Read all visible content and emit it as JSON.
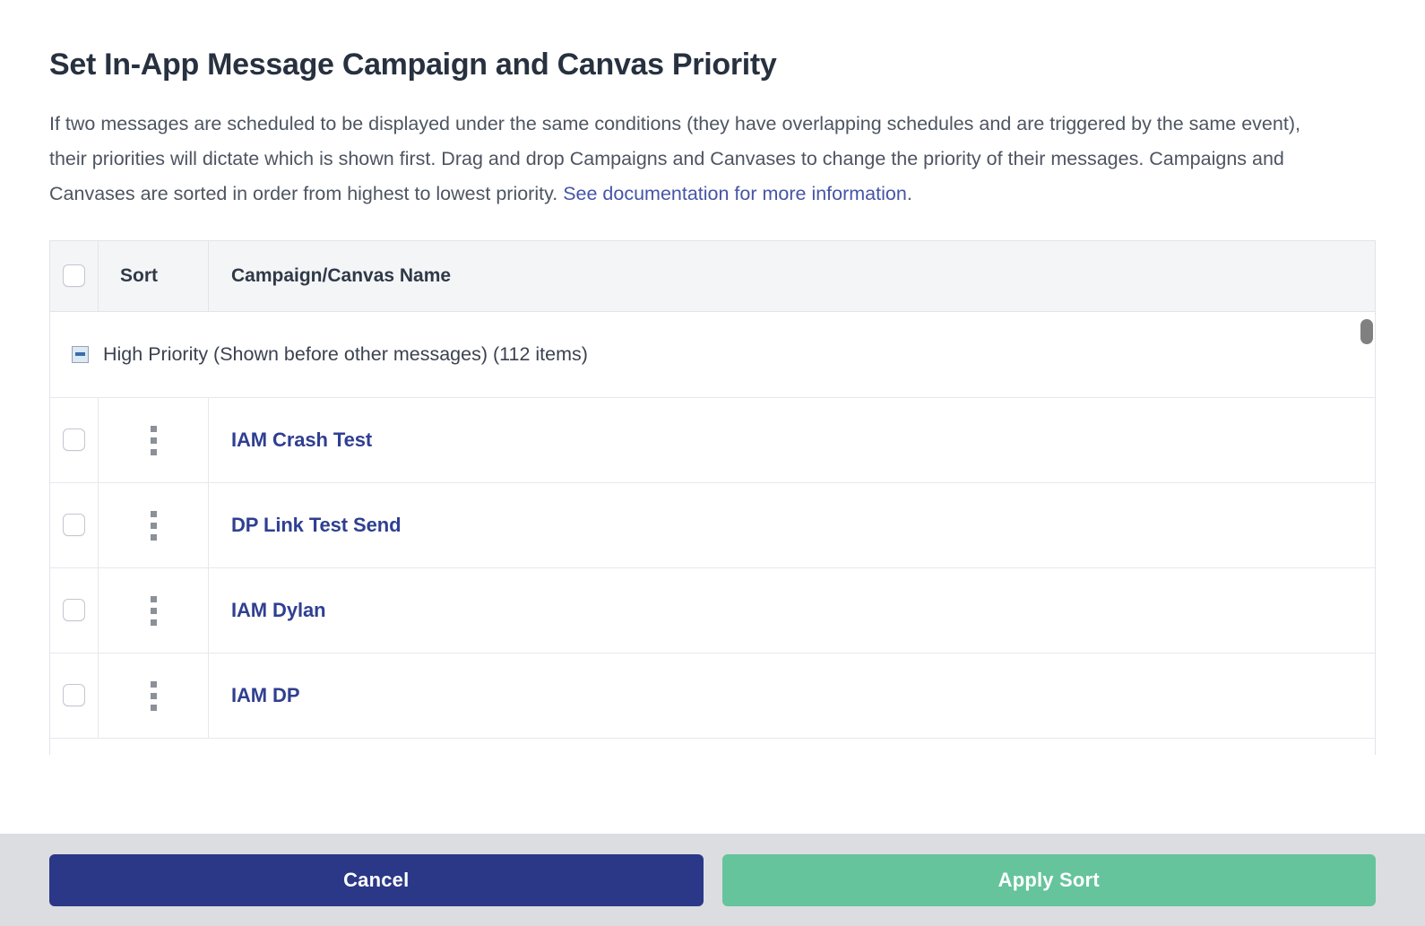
{
  "dialog": {
    "title": "Set In-App Message Campaign and Canvas Priority",
    "description_before_link": "If two messages are scheduled to be displayed under the same conditions (they have overlapping schedules and are triggered by the same event), their priorities will dictate which is shown first. Drag and drop Campaigns and Canvases to change the priority of their messages. Campaigns and Canvases are sorted in order from highest to lowest priority. ",
    "link_text": "See documentation for more information",
    "description_after_link": "."
  },
  "table": {
    "headers": {
      "select_all": "",
      "sort": "Sort",
      "name": "Campaign/Canvas Name"
    },
    "group": {
      "label": "High Priority (Shown before other messages) (112 items)",
      "expanded": true,
      "toggle_icon": "collapse-minus-icon"
    },
    "rows": [
      {
        "name": "IAM Crash Test"
      },
      {
        "name": "DP Link Test Send"
      },
      {
        "name": "IAM Dylan"
      },
      {
        "name": "IAM DP"
      }
    ]
  },
  "footer": {
    "cancel_label": "Cancel",
    "apply_label": "Apply Sort"
  },
  "colors": {
    "link": "#4654a8",
    "row_link": "#2f3f91",
    "cancel_button": "#2a3887",
    "apply_button": "#65c49c",
    "footer_background": "#dcdde1",
    "table_header_background": "#f4f5f7"
  }
}
